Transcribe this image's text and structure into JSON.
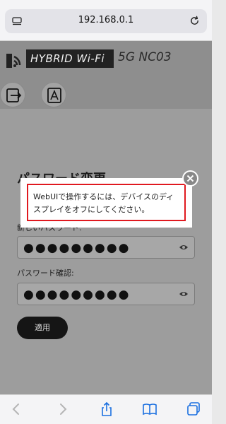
{
  "browser": {
    "url": "192.168.0.1"
  },
  "header": {
    "brand": "HYBRID Wi-Fi",
    "model": "5G NC03"
  },
  "form": {
    "title": "パスワード変更",
    "new_password_label": "新しいパスワード:",
    "new_password_value": "●●●●●●●●●",
    "confirm_password_label": "パスワード確認:",
    "confirm_password_value": "●●●●●●●●●",
    "apply_label": "適用"
  },
  "modal": {
    "message": "WebUIで操作するには、デバイスのディスプレイをオフにしてください。"
  },
  "colors": {
    "modal_border": "#e0191f",
    "apply_button": "#151515",
    "overlay": "#9a9a9a"
  },
  "icons": [
    "menu-icon",
    "reload-icon",
    "logo-wifi-icon",
    "logout-icon",
    "text-size-icon",
    "eye-icon",
    "close-icon",
    "back-icon",
    "forward-icon",
    "share-icon",
    "bookmarks-icon",
    "tabs-icon"
  ]
}
